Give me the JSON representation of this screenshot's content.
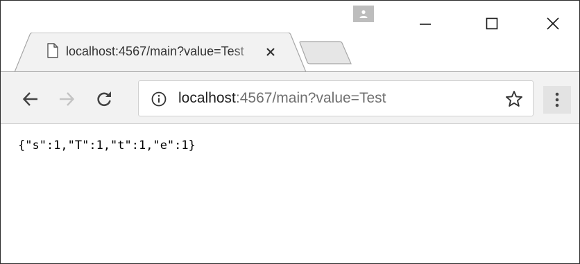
{
  "tab": {
    "title": "localhost:4567/main?value=Test"
  },
  "address_bar": {
    "host": "localhost",
    "rest": ":4567/main?value=Test"
  },
  "page": {
    "body_text": "{\"s\":1,\"T\":1,\"t\":1,\"e\":1}"
  },
  "icons": {
    "tab": "page-icon",
    "tab_close": "close-icon",
    "window": [
      "minimize-icon",
      "maximize-icon",
      "close-icon"
    ],
    "profile": "person-icon",
    "nav": [
      "back-arrow-icon",
      "forward-arrow-icon",
      "reload-icon"
    ],
    "site_info": "info-icon",
    "bookmark": "star-icon",
    "menu": "more-vertical-icon"
  },
  "colors": {
    "toolbar_bg": "#f2f2f2",
    "profile_bg": "#bdbdbd",
    "url_host": "#1f1f1f",
    "url_rest": "#6f6f6f"
  }
}
